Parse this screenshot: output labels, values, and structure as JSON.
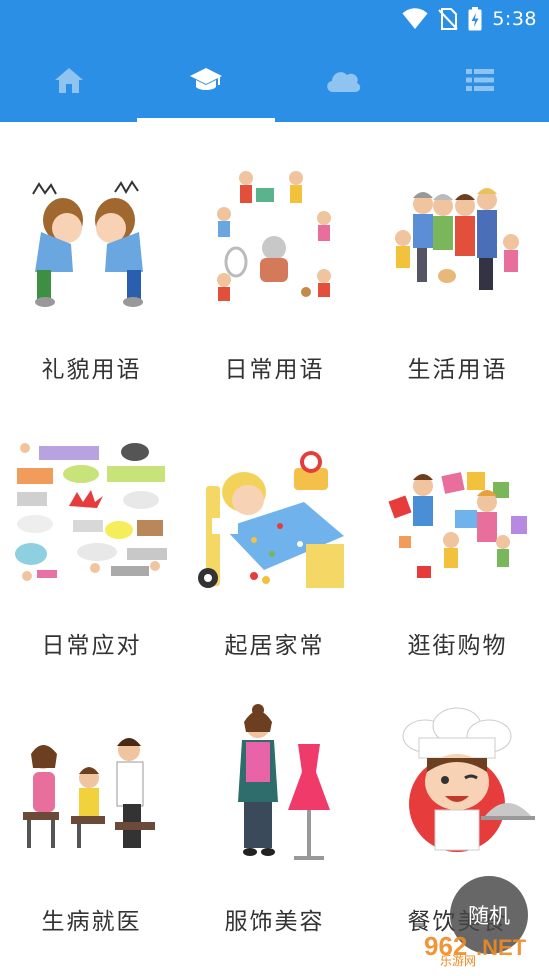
{
  "status_bar": {
    "time": "5:38",
    "icons": [
      "wifi-icon",
      "no-sim-icon",
      "battery-charging-icon"
    ],
    "bg_color": "#2b8fe5"
  },
  "tabs": [
    {
      "icon": "home-icon",
      "active": false
    },
    {
      "icon": "graduation-cap-icon",
      "active": true
    },
    {
      "icon": "cloud-icon",
      "active": false
    },
    {
      "icon": "list-icon",
      "active": false
    }
  ],
  "categories": [
    {
      "label": "礼貌用语",
      "icon": "bowing-kids-illustration"
    },
    {
      "label": "日常用语",
      "icon": "daily-life-collage-illustration"
    },
    {
      "label": "生活用语",
      "icon": "family-group-illustration"
    },
    {
      "label": "日常应对",
      "icon": "speech-bubbles-illustration"
    },
    {
      "label": "起居家常",
      "icon": "child-in-bed-illustration"
    },
    {
      "label": "逛街购物",
      "icon": "shopping-family-illustration"
    },
    {
      "label": "生病就医",
      "icon": "doctor-visit-illustration"
    },
    {
      "label": "服饰美容",
      "icon": "tailor-mannequin-illustration"
    },
    {
      "label": "餐饮美食",
      "icon": "chef-illustration"
    }
  ],
  "fab": {
    "label": "随机"
  },
  "watermark": {
    "brand": "962.NET",
    "text": "乐游网"
  }
}
